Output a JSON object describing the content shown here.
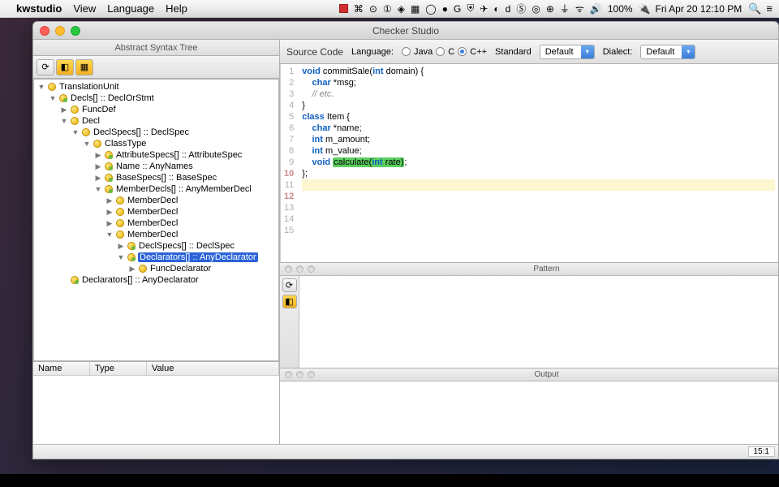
{
  "menubar": {
    "app": "kwstudio",
    "items": [
      "View",
      "Language",
      "Help"
    ],
    "battery": "100%",
    "clock": "Fri Apr 20  12:10 PM"
  },
  "window": {
    "title": "Checker Studio",
    "ast_title": "Abstract Syntax Tree",
    "source_label": "Source Code",
    "lang_label": "Language:",
    "langs": {
      "java": "Java",
      "c": "C",
      "cpp": "C++"
    },
    "std_label": "Standard",
    "std_value": "Default",
    "dialect_label": "Dialect:",
    "dialect_value": "Default",
    "pattern_title": "Pattern",
    "output_title": "Output",
    "status_pos": "15:1"
  },
  "tree": [
    {
      "d": 0,
      "e": "d",
      "i": "y",
      "t": "TranslationUnit"
    },
    {
      "d": 1,
      "e": "d",
      "i": "h",
      "t": "Decls[] :: DeclOrStmt"
    },
    {
      "d": 2,
      "e": "r",
      "i": "y",
      "t": "FuncDef"
    },
    {
      "d": 2,
      "e": "d",
      "i": "y",
      "t": "Decl"
    },
    {
      "d": 3,
      "e": "d",
      "i": "y",
      "t": "DeclSpecs[] :: DeclSpec"
    },
    {
      "d": 4,
      "e": "d",
      "i": "y",
      "t": "ClassType"
    },
    {
      "d": 5,
      "e": "r",
      "i": "h",
      "t": "AttributeSpecs[] :: AttributeSpec"
    },
    {
      "d": 5,
      "e": "r",
      "i": "h",
      "t": "Name :: AnyNames"
    },
    {
      "d": 5,
      "e": "r",
      "i": "h",
      "t": "BaseSpecs[] :: BaseSpec"
    },
    {
      "d": 5,
      "e": "d",
      "i": "h",
      "t": "MemberDecls[] :: AnyMemberDecl"
    },
    {
      "d": 6,
      "e": "r",
      "i": "y",
      "t": "MemberDecl"
    },
    {
      "d": 6,
      "e": "r",
      "i": "y",
      "t": "MemberDecl"
    },
    {
      "d": 6,
      "e": "r",
      "i": "y",
      "t": "MemberDecl"
    },
    {
      "d": 6,
      "e": "d",
      "i": "y",
      "t": "MemberDecl"
    },
    {
      "d": 7,
      "e": "r",
      "i": "h",
      "t": "DeclSpecs[] :: DeclSpec"
    },
    {
      "d": 7,
      "e": "d",
      "i": "h",
      "t": "Declarators[] :: AnyDeclarator",
      "sel": true
    },
    {
      "d": 8,
      "e": "r",
      "i": "y",
      "t": "FuncDeclarator"
    },
    {
      "d": 2,
      "e": "",
      "i": "h",
      "t": "Declarators[] :: AnyDeclarator"
    }
  ],
  "props": {
    "h1": "Name",
    "h2": "Type",
    "h3": "Value"
  },
  "code": {
    "lines": [
      {
        "n": 1,
        "html": "<span class='kw'>void</span> commitSale(<span class='ty'>int</span> domain) {"
      },
      {
        "n": 2,
        "html": "    <span class='ty'>char</span> *msg;"
      },
      {
        "n": 3,
        "html": "    <span class='cm'>// etc.</span>"
      },
      {
        "n": 4,
        "html": "}"
      },
      {
        "n": 5,
        "html": ""
      },
      {
        "n": 6,
        "html": ""
      },
      {
        "n": 7,
        "html": "<span class='kw'>class</span> Item {"
      },
      {
        "n": 8,
        "html": ""
      },
      {
        "n": 9,
        "html": "    <span class='ty'>char</span> *name;"
      },
      {
        "n": 10,
        "em": true,
        "html": "    <span class='ty'>int</span> m_amount;"
      },
      {
        "n": 11,
        "html": "    <span class='ty'>int</span> m_value;"
      },
      {
        "n": 12,
        "em": true,
        "html": "    <span class='kw'>void</span> <span class='hl-call'>calculate(<span class='ty'>int</span> rate)</span>;"
      },
      {
        "n": 13,
        "html": ""
      },
      {
        "n": 14,
        "html": "};"
      },
      {
        "n": 15,
        "hl": true,
        "html": " "
      }
    ]
  }
}
